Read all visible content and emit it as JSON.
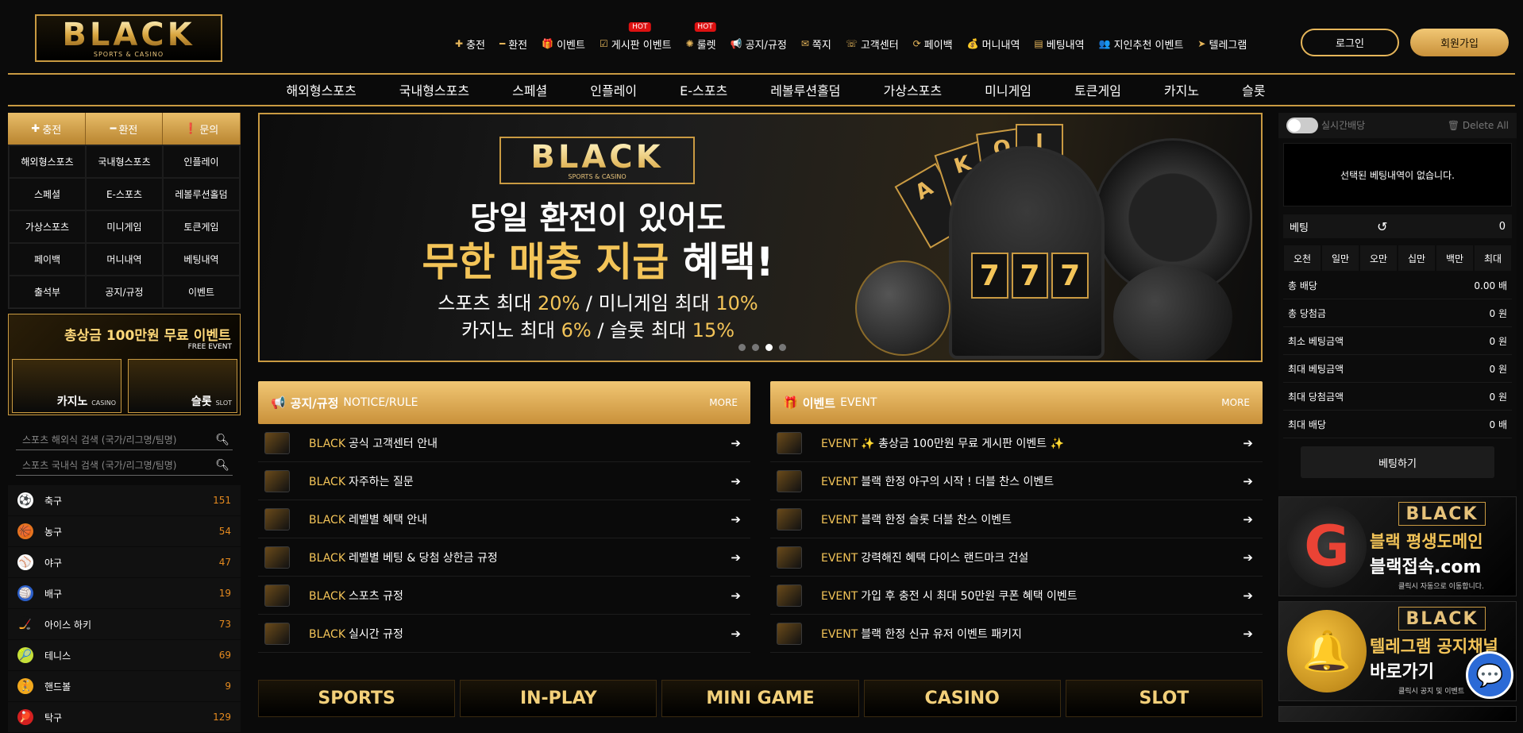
{
  "header": {
    "logo_text": "BLACK",
    "logo_sub": "SPORTS & CASINO",
    "nav": [
      {
        "icon": "plus-icon",
        "glyph": "✚",
        "label": "충전"
      },
      {
        "icon": "minus-icon",
        "glyph": "━",
        "label": "환전"
      },
      {
        "icon": "gift-icon",
        "glyph": "🎁",
        "label": "이벤트"
      },
      {
        "icon": "check-icon",
        "glyph": "☑",
        "label": "게시판 이벤트",
        "badge": "HOT"
      },
      {
        "icon": "roulette-icon",
        "glyph": "✺",
        "label": "룰렛",
        "badge": "HOT"
      },
      {
        "icon": "megaphone-icon",
        "glyph": "📢",
        "label": "공지/규정"
      },
      {
        "icon": "envelope-icon",
        "glyph": "✉",
        "label": "쪽지"
      },
      {
        "icon": "chat-icon",
        "glyph": "☏",
        "label": "고객센터"
      },
      {
        "icon": "refresh-icon",
        "glyph": "⟳",
        "label": "페이백"
      },
      {
        "icon": "moneybag-icon",
        "glyph": "💰",
        "label": "머니내역"
      },
      {
        "icon": "ticket-icon",
        "glyph": "▤",
        "label": "베팅내역"
      },
      {
        "icon": "users-icon",
        "glyph": "👥",
        "label": "지인추천 이벤트"
      },
      {
        "icon": "telegram-icon",
        "glyph": "➤",
        "label": "텔레그램"
      }
    ],
    "login_label": "로그인",
    "join_label": "회원가입"
  },
  "main_nav": [
    "해외형스포츠",
    "국내형스포츠",
    "스페셜",
    "인플레이",
    "E-스포츠",
    "레볼루션홀덤",
    "가상스포츠",
    "미니게임",
    "토큰게임",
    "카지노",
    "슬롯"
  ],
  "sidebar": {
    "quick": [
      {
        "glyph": "✚",
        "label": "충전"
      },
      {
        "glyph": "━",
        "label": "환전"
      },
      {
        "glyph": "❗",
        "label": "문의"
      }
    ],
    "grid": [
      "해외형스포츠",
      "국내형스포츠",
      "인플레이",
      "스페셜",
      "E-스포츠",
      "레볼루션홀덤",
      "가상스포츠",
      "미니게임",
      "토큰게임",
      "페이백",
      "머니내역",
      "베팅내역",
      "출석부",
      "공지/규정",
      "이벤트"
    ],
    "promo": {
      "title": "총상금 100만원 무료 이벤트",
      "tag": "FREE EVENT",
      "casino": "카지노",
      "casino_sub": "CASINO",
      "slot": "슬롯",
      "slot_sub": "SLOT"
    },
    "search_overseas": "스포츠 해외식 검색 (국가/리그명/팀명)",
    "search_domestic": "스포츠 국내식 검색 (국가/리그명/팀명)",
    "sports": [
      {
        "name": "축구",
        "count": "151",
        "glyph": "⚽",
        "bg": "#ffffff"
      },
      {
        "name": "농구",
        "count": "54",
        "glyph": "🏀",
        "bg": "#e5731f"
      },
      {
        "name": "야구",
        "count": "47",
        "glyph": "⚾",
        "bg": "#ffffff"
      },
      {
        "name": "배구",
        "count": "19",
        "glyph": "🏐",
        "bg": "#2b5fc9"
      },
      {
        "name": "아이스 하키",
        "count": "73",
        "glyph": "🏒",
        "bg": "#111111"
      },
      {
        "name": "테니스",
        "count": "69",
        "glyph": "🎾",
        "bg": "#c6e03a"
      },
      {
        "name": "핸드볼",
        "count": "9",
        "glyph": "🤾",
        "bg": "#f2a81d"
      },
      {
        "name": "탁구",
        "count": "129",
        "glyph": "🏓",
        "bg": "#d42020"
      }
    ]
  },
  "banner": {
    "logo": "BLACK",
    "logo_sub": "SPORTS & CASINO",
    "line1": "당일 환전이 있어도",
    "line2_gold": "무한 매충 지급",
    "line2_white": "혜택!",
    "line3a": "스포츠 최대",
    "line3b": "20%",
    "line3c": "/ 미니게임 최대",
    "line3d": "10%",
    "line4a": "카지노 최대",
    "line4b": "6%",
    "line4c": "/ 슬롯 최대",
    "line4d": "15%",
    "reel": "7"
  },
  "notice": {
    "title": "공지/규정",
    "sub": "NOTICE/RULE",
    "more": "MORE",
    "items": [
      {
        "prefix": "BLACK",
        "text": "공식 고객센터 안내"
      },
      {
        "prefix": "BLACK",
        "text": "자주하는 질문"
      },
      {
        "prefix": "BLACK",
        "text": "레벨별 혜택 안내"
      },
      {
        "prefix": "BLACK",
        "text": "레벨별 베팅 & 당첨 상한금 규정"
      },
      {
        "prefix": "BLACK",
        "text": "스포츠 규정"
      },
      {
        "prefix": "BLACK",
        "text": "실시간 규정"
      }
    ]
  },
  "event": {
    "title": "이벤트",
    "sub": "EVENT",
    "more": "MORE",
    "items": [
      {
        "prefix": "EVENT",
        "text": "✨ 총상금 100만원 무료 게시판 이벤트 ✨"
      },
      {
        "prefix": "EVENT",
        "text": "블랙 한정 야구의 시작 ! 더블 찬스 이벤트"
      },
      {
        "prefix": "EVENT",
        "text": "블랙 한정 슬롯 더블 찬스 이벤트"
      },
      {
        "prefix": "EVENT",
        "text": "강력해진 혜택 다이스 랜드마크 건설"
      },
      {
        "prefix": "EVENT",
        "text": "가입 후 충전 시 최대 50만원 쿠폰 혜택 이벤트"
      },
      {
        "prefix": "EVENT",
        "text": "블랙 한정 신규 유저 이벤트 패키지"
      }
    ]
  },
  "games": [
    "SPORTS",
    "IN-PLAY",
    "MINI GAME",
    "CASINO",
    "SLOT"
  ],
  "betslip": {
    "live_label": "실시간배당",
    "delete_all": "Delete All",
    "empty": "선택된 베팅내역이 없습니다.",
    "bet_label": "베팅",
    "bet_value": "0",
    "chips": [
      "오천",
      "일만",
      "오만",
      "십만",
      "백만",
      "최대"
    ],
    "info": [
      {
        "label": "총 배당",
        "value": "0.00 배"
      },
      {
        "label": "총 당첨금",
        "value": "0 원"
      },
      {
        "label": "최소 베팅금액",
        "value": "0 원"
      },
      {
        "label": "최대 베팅금액",
        "value": "0 원"
      },
      {
        "label": "최대 당첨금액",
        "value": "0 원"
      },
      {
        "label": "최대 배당",
        "value": "0 배"
      }
    ],
    "bet_button": "베팅하기"
  },
  "right_banners": [
    {
      "logo": "BLACK",
      "line1": "블랙 평생도메인",
      "line2": "블랙접속.com",
      "line3": "클릭시 자동으로 이동합니다."
    },
    {
      "logo": "BLACK",
      "line1": "텔레그램 공지채널",
      "line2": "바로가기 ",
      "line3": "클릭시 공지 및 이벤트"
    }
  ],
  "colors": {
    "gold": "#e6b65a",
    "background": "#0a0a0a",
    "count": "#e58a1f",
    "hot": "#dd1111"
  }
}
